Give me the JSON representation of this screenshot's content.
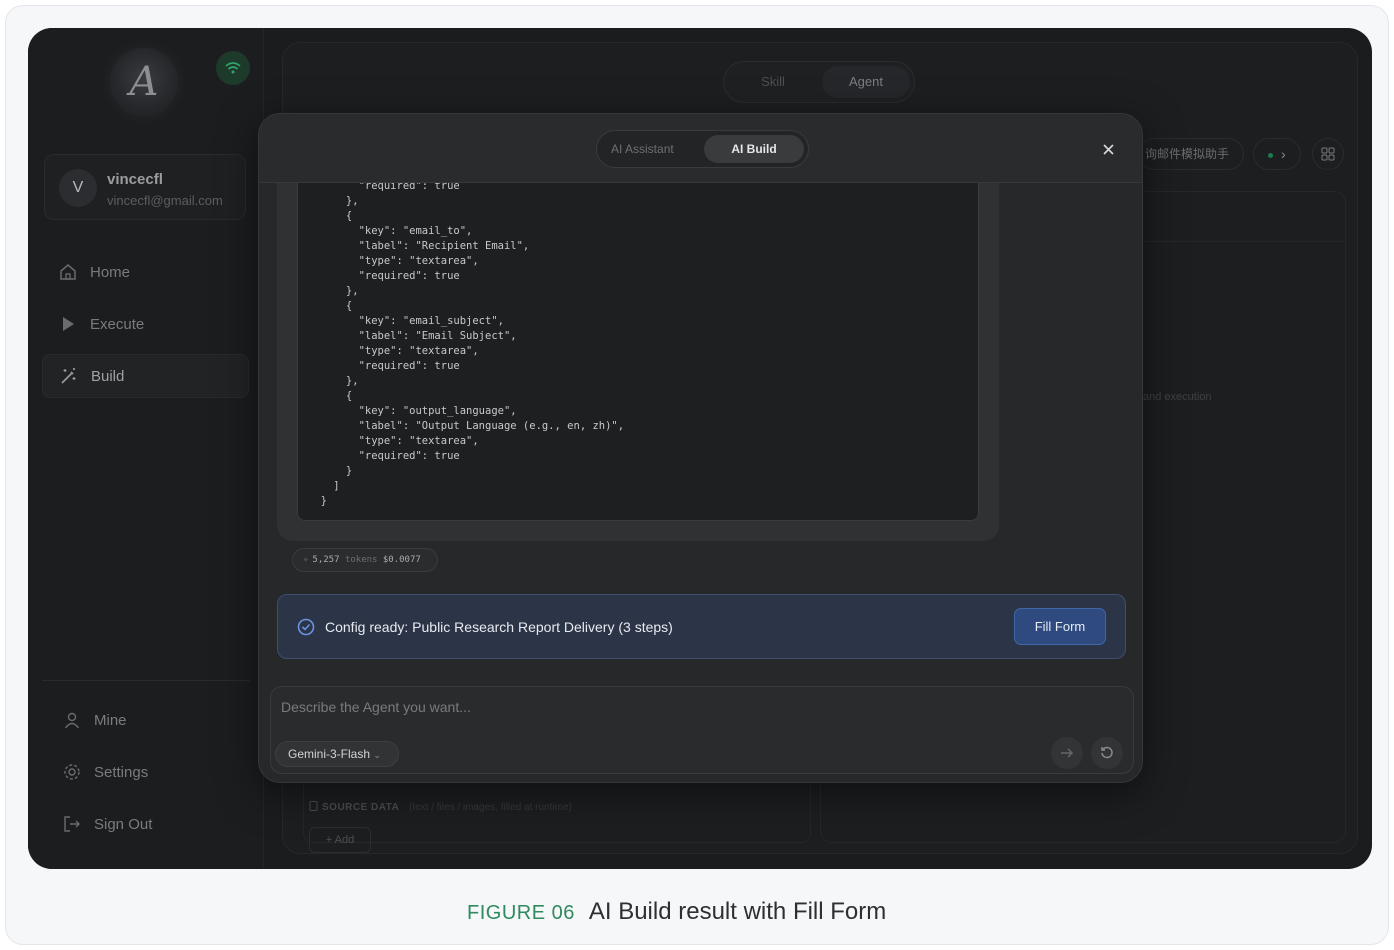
{
  "app": {
    "logo_letter": "A",
    "user": {
      "initial": "V",
      "name": "vincecfl",
      "email": "vincecfl@gmail.com"
    },
    "nav": [
      {
        "label": "Home",
        "icon": "home-icon"
      },
      {
        "label": "Execute",
        "icon": "play-icon"
      },
      {
        "label": "Build",
        "icon": "magic-wand-icon",
        "active": true
      }
    ],
    "nav_bottom": [
      {
        "label": "Mine",
        "icon": "user-icon"
      },
      {
        "label": "Settings",
        "icon": "gear-icon"
      },
      {
        "label": "Sign Out",
        "icon": "sign-out-icon"
      }
    ]
  },
  "main": {
    "mode_tabs": [
      "Skill",
      "Agent"
    ],
    "active_mode": "Agent",
    "agent_chip": "询邮件模拟助手",
    "faint_text": "and execution",
    "source_label": "SOURCE DATA",
    "source_hint": "(text / files / images, filled at runtime)",
    "add_label": "+ Add"
  },
  "modal": {
    "tabs": [
      "AI Assistant",
      "AI Build"
    ],
    "active_tab": "AI Build",
    "code": "        \"required\": true\n      },\n      {\n        \"key\": \"email_to\",\n        \"label\": \"Recipient Email\",\n        \"type\": \"textarea\",\n        \"required\": true\n      },\n      {\n        \"key\": \"email_subject\",\n        \"label\": \"Email Subject\",\n        \"type\": \"textarea\",\n        \"required\": true\n      },\n      {\n        \"key\": \"output_language\",\n        \"label\": \"Output Language (e.g., en, zh)\",\n        \"type\": \"textarea\",\n        \"required\": true\n      }\n    ]\n  }",
    "tokens": "5,257",
    "tokens_unit": "tokens",
    "cost": "$0.0077",
    "config_text": "Config ready: Public Research Report Delivery (3 steps)",
    "fill_button": "Fill Form",
    "input_placeholder": "Describe the Agent you want...",
    "model": "Gemini-3-Flash"
  },
  "caption": {
    "figure": "FIGURE 06",
    "title": "AI Build result with Fill Form"
  },
  "colors": {
    "accent": "#2e4a7e",
    "figure_label": "#2f8a5e",
    "online": "#1f7a4d"
  }
}
